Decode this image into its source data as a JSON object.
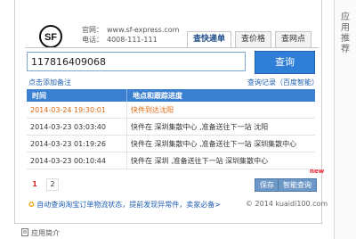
{
  "side_panel": {
    "label": "应用推荐"
  },
  "header": {
    "website_label": "官网：",
    "website_value": "www.sf-express.com",
    "phone_label": "电话：",
    "phone_value": "4008-111-111",
    "tabs": [
      "查快递单",
      "查价格",
      "查网点"
    ]
  },
  "search": {
    "value": "117816409068",
    "button": "查询"
  },
  "links": {
    "add_note": "点击添加备注",
    "history": "查询记录（百度智能）"
  },
  "table": {
    "headers": [
      "时间",
      "地点和跟踪进度"
    ],
    "rows": [
      {
        "time": "2014-03-24 19:30:01",
        "detail": "快件到达沈阳"
      },
      {
        "time": "2014-03-23 03:03:40",
        "detail": "快件在 深圳集散中心 ,准备送往下一站 沈阳"
      },
      {
        "time": "2014-03-23 01:19:26",
        "detail": "快件在 深圳集散中心 ,准备送往下一站 深圳集散中心"
      },
      {
        "time": "2014-03-23 00:10:44",
        "detail": "快件在 深圳 ,准备送往下一站 深圳集散中心"
      }
    ]
  },
  "pager": {
    "pages": [
      "1",
      "2"
    ],
    "current": "1"
  },
  "actions": {
    "save": "保存",
    "smart_reminder": "智能查询",
    "badge": "new"
  },
  "footer": {
    "auto_query": "自动查询淘宝订单物流状态，提前发现异常件，卖家必备>",
    "copyright": "© 2014 kuaidi100.com"
  },
  "bottom": {
    "app_intro": "应用简介"
  },
  "colors": {
    "accent": "#2f7ed8",
    "header_row": "#3a7fd0",
    "highlight": "#e06a10",
    "link": "#1f5fb4"
  }
}
